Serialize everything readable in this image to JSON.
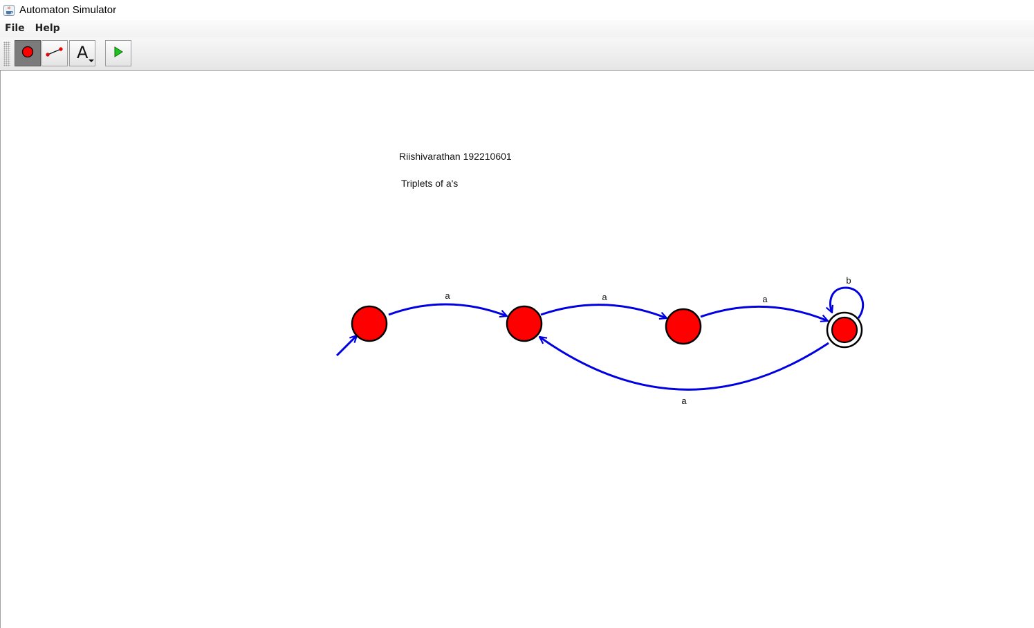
{
  "window": {
    "title": "Automaton Simulator",
    "app_icon": "java-cup-icon"
  },
  "menubar": {
    "items": [
      {
        "label": "File"
      },
      {
        "label": "Help"
      }
    ]
  },
  "toolbar": {
    "tools": [
      {
        "name": "state-tool",
        "icon": "red-circle-icon",
        "active": true
      },
      {
        "name": "transition-tool",
        "icon": "edge-line-icon",
        "active": false
      },
      {
        "name": "text-tool",
        "icon": "letter-a-dropdown-icon",
        "glyph": "A",
        "active": false
      },
      {
        "name": "run-tool",
        "icon": "green-play-icon",
        "active": false
      }
    ]
  },
  "canvas": {
    "notes": {
      "author": "Riishivarathan 192210601",
      "description": "Triplets of a's"
    },
    "automaton": {
      "colors": {
        "state_fill": "#ff0000",
        "state_stroke": "#000000",
        "transition": "#0000e0"
      },
      "states": [
        {
          "id": "q0",
          "initial": true,
          "accepting": false
        },
        {
          "id": "q1",
          "initial": false,
          "accepting": false
        },
        {
          "id": "q2",
          "initial": false,
          "accepting": false
        },
        {
          "id": "q3",
          "initial": false,
          "accepting": true
        }
      ],
      "transitions": [
        {
          "from": "q0",
          "to": "q1",
          "label": "a"
        },
        {
          "from": "q1",
          "to": "q2",
          "label": "a"
        },
        {
          "from": "q2",
          "to": "q3",
          "label": "a"
        },
        {
          "from": "q3",
          "to": "q1",
          "label": "a"
        },
        {
          "from": "q3",
          "to": "q3",
          "label": "b"
        }
      ]
    }
  }
}
